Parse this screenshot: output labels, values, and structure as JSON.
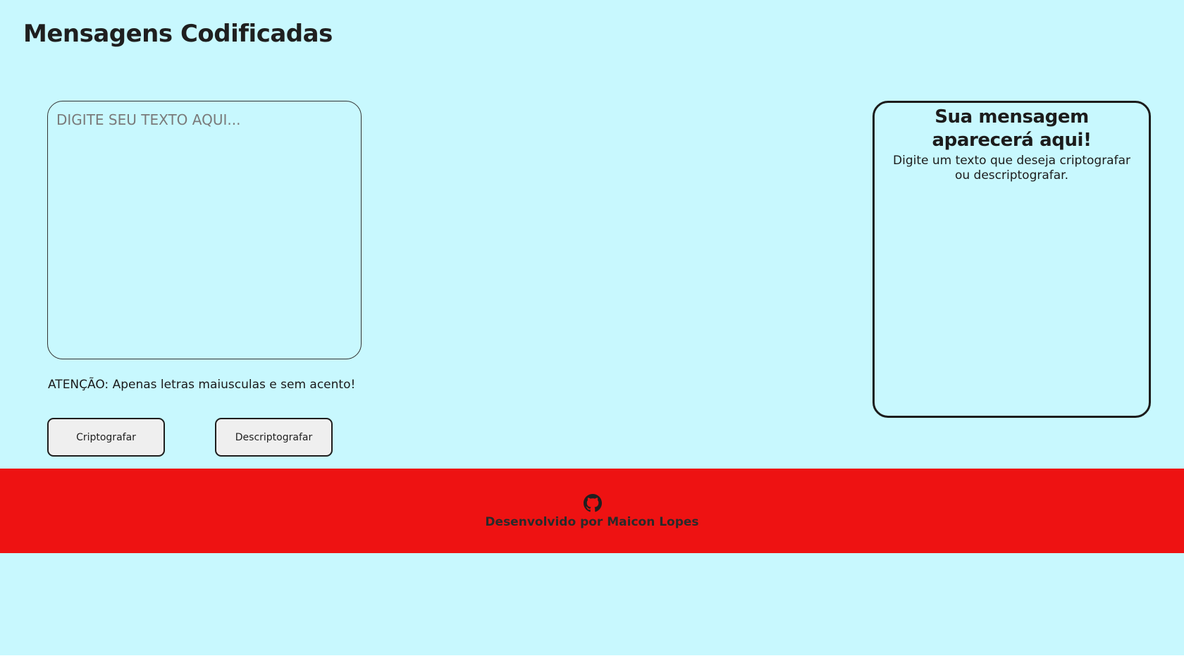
{
  "header": {
    "title": "Mensagens Codificadas"
  },
  "input": {
    "placeholder": "DIGITE SEU TEXTO AQUI...",
    "value": ""
  },
  "warning": "ATENÇÃO: Apenas letras maiusculas e sem acento!",
  "buttons": {
    "encrypt_label": "Criptografar",
    "decrypt_label": "Descriptografar"
  },
  "output": {
    "title": "Sua mensagem aparecerá aqui!",
    "text": "Digite um texto que deseja criptografar ou descriptografar."
  },
  "footer": {
    "icon": "github-icon",
    "credit": "Desenvolvido por Maicon Lopes"
  },
  "colors": {
    "background": "#c8f8fe",
    "footer": "#ee1212",
    "text": "#1f1f1f"
  }
}
